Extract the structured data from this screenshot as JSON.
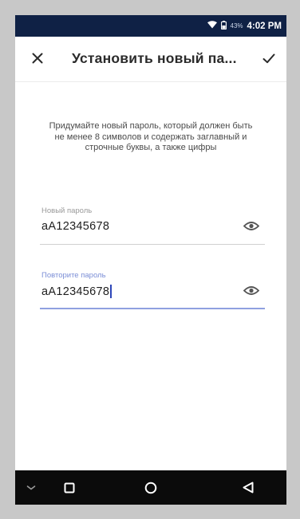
{
  "status_bar": {
    "battery_percent": "43%",
    "time": "4:02 PM",
    "icons": [
      "wifi-icon",
      "battery-icon"
    ],
    "background": "#0f2145"
  },
  "app_bar": {
    "title": "Установить новый па...",
    "close_icon": "close-icon",
    "confirm_icon": "check-icon"
  },
  "description": "Придумайте новый пароль, который должен быть не менее 8 символов и содержать заглавный и строчные буквы, а также цифры",
  "fields": {
    "new_password": {
      "label": "Новый пароль",
      "value": "aA12345678",
      "icon": "eye-icon"
    },
    "repeat_password": {
      "label": "Повторите пароль",
      "value": "aA12345678",
      "icon": "eye-icon",
      "focused": true,
      "accent": "#8fa0e0"
    }
  },
  "nav_bar": {
    "buttons": [
      "hide-keyboard-icon",
      "recents-icon",
      "home-icon",
      "back-icon"
    ]
  }
}
